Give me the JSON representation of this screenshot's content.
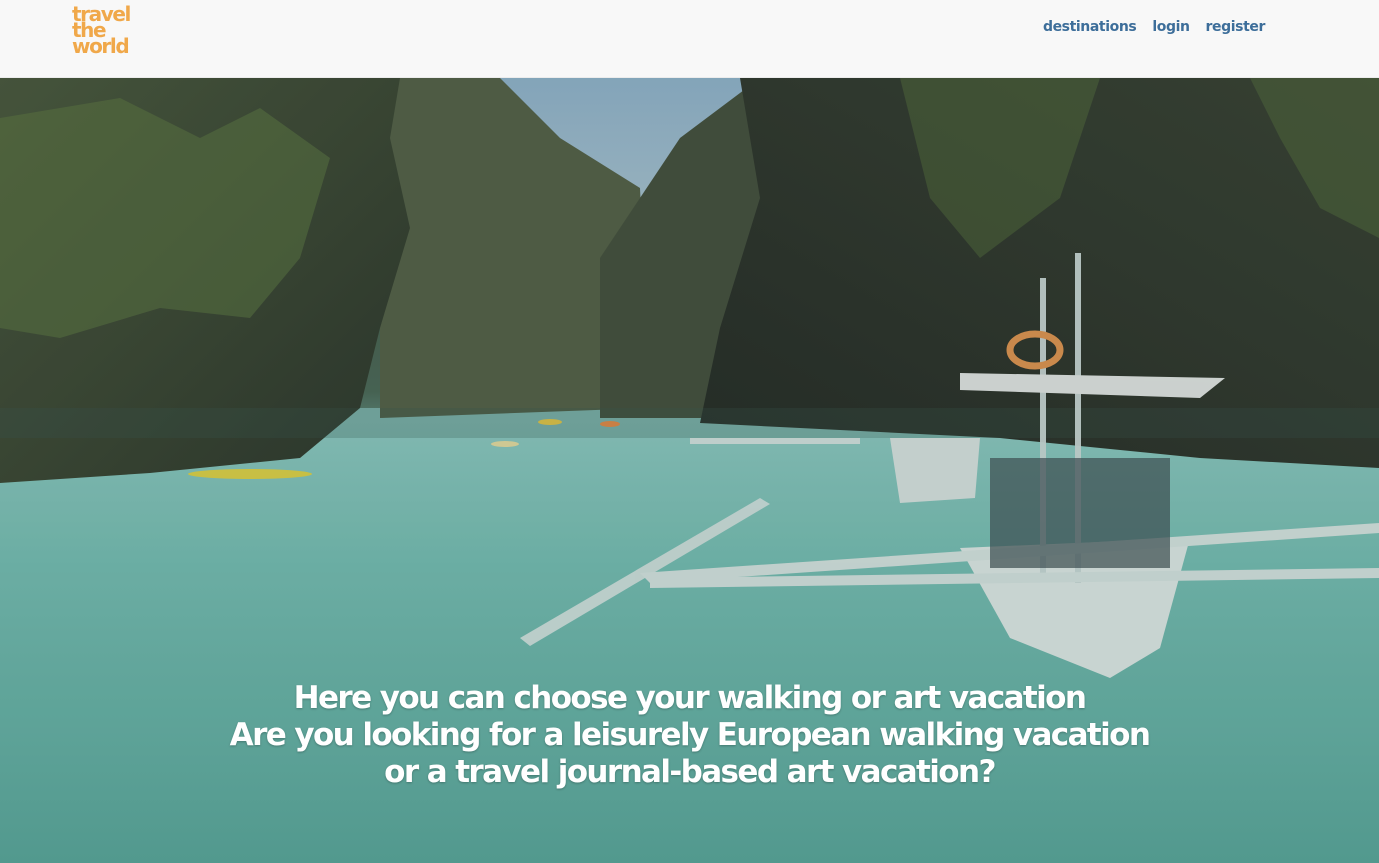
{
  "brand": {
    "logo_lines": [
      "travel",
      "the",
      "world"
    ],
    "color": "#f0a84a"
  },
  "nav": {
    "items": [
      {
        "label": "destinations"
      },
      {
        "label": "login"
      },
      {
        "label": "register"
      }
    ],
    "color": "#3d6e9a"
  },
  "hero": {
    "image": "tropical-lagoon-boats-photo",
    "lines": [
      "Here you can choose your walking or art vacation",
      "Are you looking for a leisurely European walking vacation",
      "or a travel journal-based art vacation?"
    ]
  }
}
